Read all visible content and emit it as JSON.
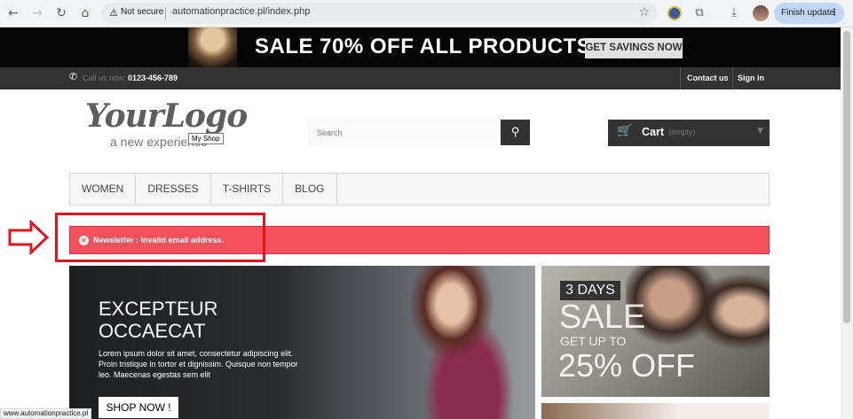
{
  "browser": {
    "security_label": "Not secure",
    "url": "automationpractice.pl/index.php",
    "update_label": "Finish update"
  },
  "banner": {
    "headline": "SALE 70% OFF ALL PRODUCTS",
    "cta": "GET SAVINGS NOW"
  },
  "topnav": {
    "call_label": "Call us now:",
    "phone": "0123-456-789",
    "contact": "Contact us",
    "signin": "Sign in"
  },
  "header": {
    "logo_main": "YourLogo",
    "logo_tagline": "a new experience",
    "logo_tooltip": "My Shop",
    "search_placeholder": "Search",
    "cart_label": "Cart",
    "cart_status": "(empty)"
  },
  "menu": {
    "items": [
      "Women",
      "Dresses",
      "T-shirts",
      "Blog"
    ]
  },
  "alert": {
    "message": "Newsletter : Invalid email address.",
    "color": "#f3515c"
  },
  "slider": {
    "heading_line1": "EXCEPTEUR",
    "heading_line2": "OCCAECAT",
    "text": "Lorem ipsum dolor sit amet, consectetur adipiscing elit. Proin tristique in tortor et dignissim. Quisque non tempor leo. Maecenas egestas sem elit",
    "button": "SHOP NOW !"
  },
  "promo": {
    "days": "3 DAYS",
    "sale": "SALE",
    "upto": "GET UP TO",
    "percent": "25% OFF"
  },
  "statusbar": {
    "text": "www.automationpractice.pl"
  }
}
